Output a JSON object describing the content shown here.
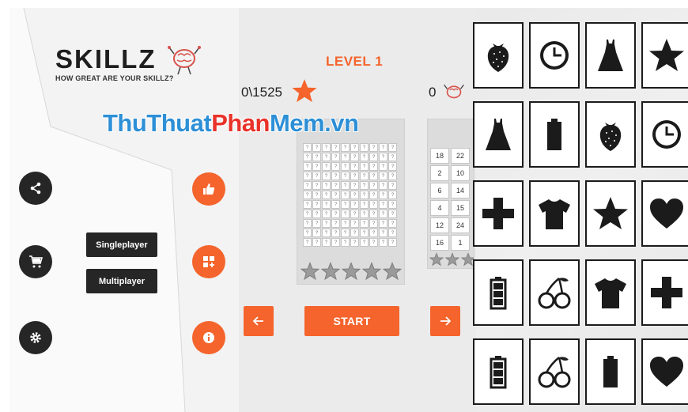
{
  "logo": {
    "title": "SKILLZ",
    "tagline": "HOW GREAT ARE YOUR SKILLZ?"
  },
  "menu": {
    "singleplayer": "Singleplayer",
    "multiplayer": "Multiplayer"
  },
  "side_buttons": [
    "share-icon",
    "cart-icon",
    "settings-icon"
  ],
  "action_buttons": [
    "thumbs-up-icon",
    "add-grid-icon",
    "info-icon"
  ],
  "game": {
    "level": "LEVEL 1",
    "score": "0\\1525",
    "multiplayer_score": "0",
    "start": "START",
    "grid_symbol": "?",
    "grid_columns": 10,
    "grid_rows": 11,
    "star_rating": 0,
    "numbers": [
      "18",
      "22",
      "2",
      "10",
      "6",
      "14",
      "4",
      "15",
      "12",
      "24",
      "16",
      "1"
    ]
  },
  "watermark": {
    "part1": "ThuThuat",
    "part2": "Phan",
    "part3": "Mem",
    "part4": ".vn"
  },
  "cards": [
    "strawberry",
    "clock",
    "dress",
    "star",
    "dress",
    "battery-full",
    "strawberry",
    "clock",
    "plus",
    "tshirt",
    "star",
    "heart",
    "battery-empty",
    "cherry",
    "tshirt",
    "plus",
    "battery-empty",
    "cherry",
    "battery-full",
    "heart"
  ],
  "colors": {
    "accent": "#f4642c",
    "dark": "#262626",
    "watermark_blue": "#2d8fd6",
    "watermark_red": "#e8322a"
  }
}
